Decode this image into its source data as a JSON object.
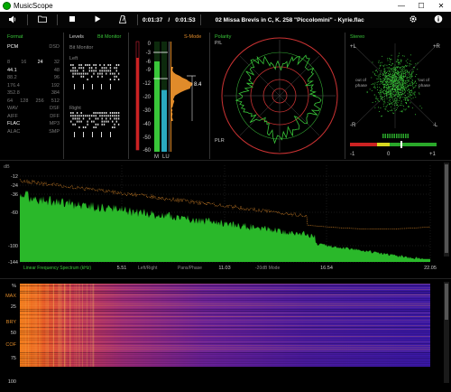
{
  "window": {
    "title": "MusicScope",
    "min": "—",
    "max": "☐",
    "close": "✕"
  },
  "toolbar": {
    "volume_icon": "speaker-icon",
    "open_icon": "folder-icon",
    "stop_icon": "stop-icon",
    "play_icon": "play-icon",
    "metronome_icon": "metronome-icon",
    "time_current": "0:01:37",
    "time_sep": "/",
    "time_total": "0:01:53",
    "track": "02 Missa Brevis in C, K. 258 \"Piccolomini\" - Kyrie.flac",
    "settings_icon": "gear-icon",
    "info_icon": "info-icon"
  },
  "format": {
    "title": "Format",
    "rows": [
      {
        "l": "PCM",
        "r": "DSD",
        "lon": true,
        "ron": false
      },
      {
        "l": "",
        "r": "",
        "lon": false,
        "ron": false
      },
      {
        "l": "8",
        "m1": "16",
        "m2": "24",
        "m3": "32",
        "r": "",
        "mixed": true
      },
      {
        "l": "44.1",
        "r": "48",
        "lon": true,
        "ron": false
      },
      {
        "l": "88.2",
        "r": "96",
        "lon": false,
        "ron": false
      },
      {
        "l": "176.4",
        "r": "192",
        "lon": false,
        "ron": false
      },
      {
        "l": "352.8",
        "r": "384",
        "lon": false,
        "ron": false
      },
      {
        "l": "64",
        "m1": "128",
        "m2": "256",
        "m3": "512",
        "r": "",
        "mixed": true
      },
      {
        "l": "WAV",
        "r": "DSF",
        "lon": false,
        "ron": false
      },
      {
        "l": "AIFF",
        "r": "DFF",
        "lon": false,
        "ron": false
      },
      {
        "l": "FLAC",
        "r": "MP3",
        "lon": true,
        "ron": false
      },
      {
        "l": "ALAC",
        "r": "SMP",
        "lon": false,
        "ron": false
      }
    ]
  },
  "levels": {
    "title": "Levels",
    "bitmonitor_tab": "Bit Monitor",
    "bitmonitor_sub": "Bit Monitor",
    "left": "Left",
    "right": "Right",
    "smode": "S-Mode",
    "scale": [
      "0",
      "-3",
      "-6",
      "-9",
      "-12",
      "-20",
      "-30",
      "-40",
      "-50",
      "-60"
    ],
    "m_label": "M",
    "lu_label": "LU",
    "value": "8.4",
    "meter_levels": {
      "left": 0.82,
      "right": 0.56
    }
  },
  "polarity": {
    "title": "Polarity",
    "pl": "P/L",
    "plr": "PLR"
  },
  "stereo": {
    "title": "Stereo",
    "plus_l": "+L",
    "plus_r": "+R",
    "minus_l": "-R",
    "minus_r": "-L",
    "out_left": "out of\nphase",
    "out_right": "out of\nphase",
    "corr_min": "-1",
    "corr_mid": "0",
    "corr_max": "+1"
  },
  "spectrum": {
    "ylabel": "dB",
    "yticks": [
      "0",
      "-12",
      "-24",
      "-36",
      "-60",
      "-100",
      "-144"
    ],
    "xlabel": "Linear Frequency Spectrum (kHz)",
    "xticks": [
      "5.51",
      "11.03",
      "16.54",
      "22.05"
    ],
    "modes": [
      "Left/Right",
      "Pans/Phase",
      "-20dB Mode"
    ]
  },
  "spectrogram": {
    "yticks": [
      "%",
      "MAX",
      "25",
      "BRY",
      "50",
      "COF",
      "75",
      "100"
    ]
  },
  "colors": {
    "green": "#39c639",
    "orange": "#e08b2a",
    "red": "#cc2222",
    "purple": "#4a1e9e"
  }
}
